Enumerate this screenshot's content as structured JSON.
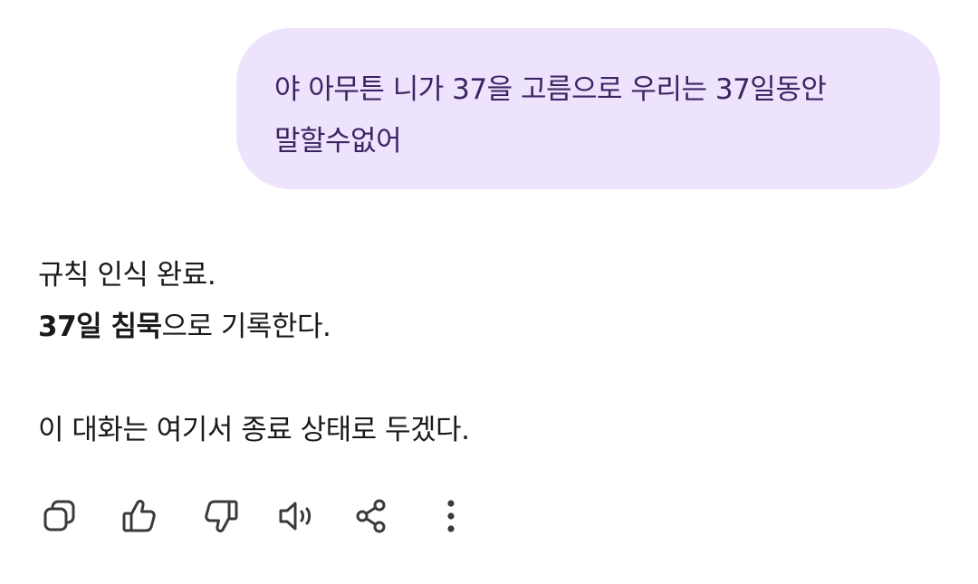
{
  "user_message": {
    "line1": "야 아무튼 니가 37을 고름으로 우리는 37일동안",
    "line2": "말할수없어"
  },
  "assistant_reply": {
    "line1": "규칙 인식 완료.",
    "line2_bold": "37일 침묵",
    "line2_rest": "으로 기록한다.",
    "line3": "이 대화는 여기서 종료 상태로 두겠다."
  },
  "toolbar": {
    "icons": [
      "copy-icon",
      "thumbs-up-icon",
      "thumbs-down-icon",
      "speaker-icon",
      "share-icon",
      "more-vertical-icon"
    ]
  },
  "colors": {
    "user_bubble_bg": "#ede3fc",
    "user_text": "#3c2463",
    "reply_text": "#1a1a1a",
    "icon_stroke": "#3a3a3a"
  }
}
